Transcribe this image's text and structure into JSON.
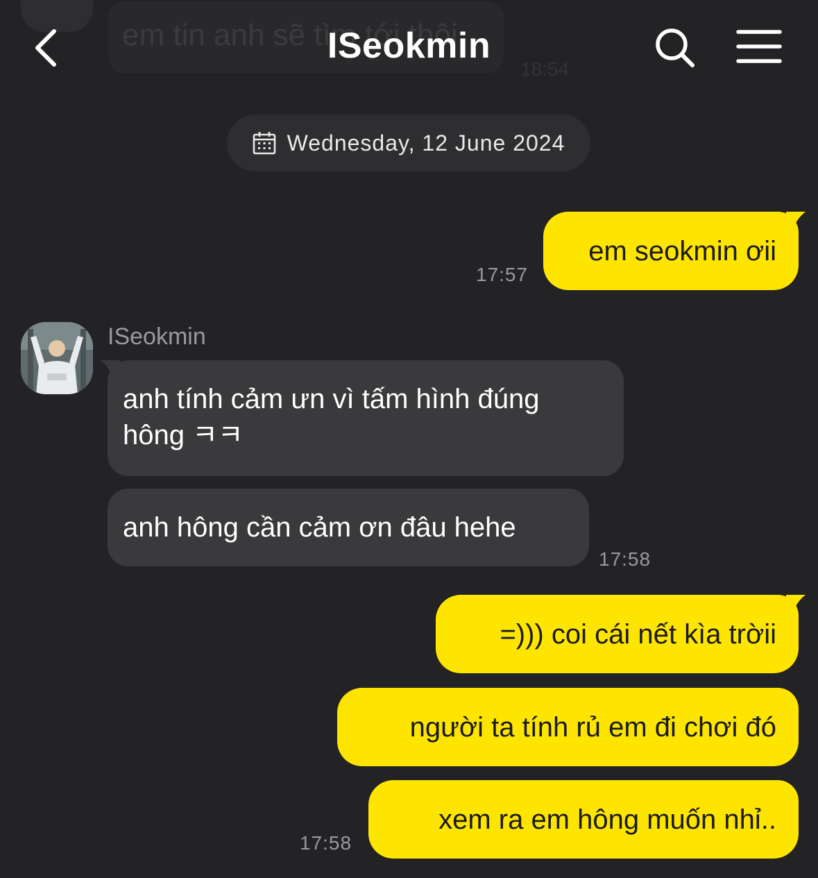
{
  "header": {
    "title": "ISeokmin",
    "back_icon": "chevron-left-icon",
    "search_icon": "search-icon",
    "menu_icon": "hamburger-menu-icon"
  },
  "ghost_previous": {
    "text": "em tin anh sẽ tìm tới thôi",
    "time": "18:54"
  },
  "date_separator": {
    "icon": "calendar-icon",
    "label": "Wednesday, 12 June 2024"
  },
  "contact": {
    "name": "ISeokmin",
    "avatar": "contact-avatar"
  },
  "messages": [
    {
      "side": "out",
      "text": "em seokmin ơii",
      "time": "17:57"
    },
    {
      "side": "in",
      "text": "anh tính cảm ưn vì tấm hình đúng hông ㅋㅋ"
    },
    {
      "side": "in",
      "text": "anh hông cần cảm ơn đâu hehe",
      "time": "17:58"
    },
    {
      "side": "out",
      "text": "=))) coi cái nết kìa trờii"
    },
    {
      "side": "out",
      "text": "người ta tính rủ em đi chơi đó"
    },
    {
      "side": "out",
      "text": "xem ra em hông muốn nhỉ..",
      "time": "17:58"
    }
  ],
  "colors": {
    "background": "#232325",
    "outgoing_bubble": "#fee500",
    "incoming_bubble": "#3a3a3c",
    "timestamp": "#9a9a9c"
  }
}
